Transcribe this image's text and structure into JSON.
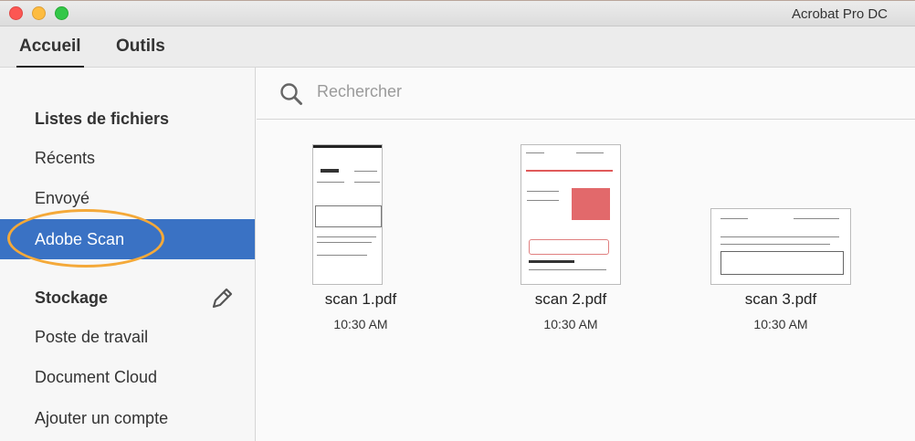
{
  "window": {
    "title": "Acrobat Pro DC"
  },
  "tabs": [
    {
      "label": "Accueil"
    },
    {
      "label": "Outils"
    }
  ],
  "sidebar": {
    "file_lists_heading": "Listes de fichiers",
    "items": [
      {
        "label": "Récents"
      },
      {
        "label": "Envoyé"
      },
      {
        "label": "Adobe Scan"
      }
    ],
    "storage_heading": "Stockage",
    "storage_items": [
      {
        "label": "Poste de travail"
      },
      {
        "label": "Document Cloud"
      },
      {
        "label": "Ajouter un compte"
      }
    ]
  },
  "search": {
    "placeholder": "Rechercher"
  },
  "files": [
    {
      "name": "scan 1.pdf",
      "time": "10:30 AM"
    },
    {
      "name": "scan 2.pdf",
      "time": "10:30 AM"
    },
    {
      "name": "scan 3.pdf",
      "time": "10:30 AM"
    }
  ],
  "colors": {
    "selected": "#3a72c4",
    "highlight_ellipse": "#f4a939"
  }
}
